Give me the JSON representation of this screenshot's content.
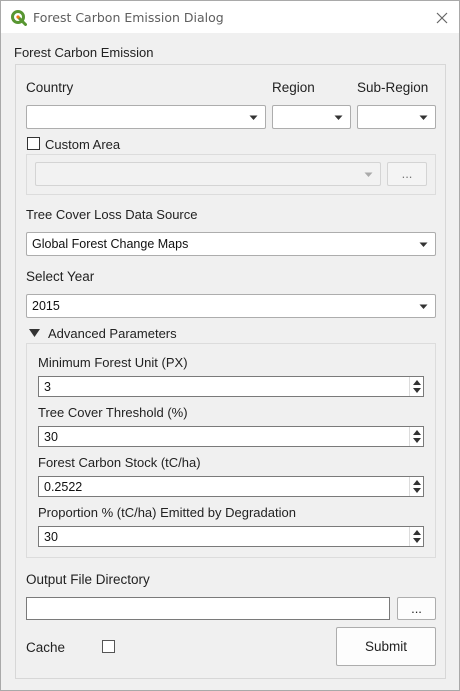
{
  "window": {
    "title": "Forest Carbon Emission Dialog"
  },
  "group": {
    "title": "Forest Carbon Emission"
  },
  "location": {
    "country_label": "Country",
    "region_label": "Region",
    "subregion_label": "Sub-Region",
    "country_value": "",
    "region_value": "",
    "subregion_value": "",
    "custom_area_label": "Custom Area",
    "custom_area_checked": false,
    "custom_area_value": "",
    "browse_label": "..."
  },
  "data_source": {
    "label": "Tree Cover Loss Data Source",
    "value": "Global Forest Change Maps"
  },
  "year": {
    "label": "Select Year",
    "value": "2015"
  },
  "advanced": {
    "label": "Advanced Parameters",
    "expanded": true,
    "params": [
      {
        "label": "Minimum Forest Unit (PX)",
        "value": "3"
      },
      {
        "label": "Tree Cover Threshold (%)",
        "value": "30"
      },
      {
        "label": "Forest Carbon Stock (tC/ha)",
        "value": "0.2522"
      },
      {
        "label": "Proportion % (tC/ha) Emitted by Degradation",
        "value": "30"
      }
    ]
  },
  "output": {
    "label": "Output File Directory",
    "value": "",
    "browse_label": "..."
  },
  "cache": {
    "label": "Cache",
    "checked": false
  },
  "submit": {
    "label": "Submit"
  },
  "colors": {
    "qgis_green": "#589632",
    "qgis_yellow": "#ee7913"
  },
  "icons": {
    "app": "qgis-logo-icon",
    "close": "close-icon",
    "dropdown": "chevron-down-icon",
    "expand": "triangle-down-icon"
  }
}
